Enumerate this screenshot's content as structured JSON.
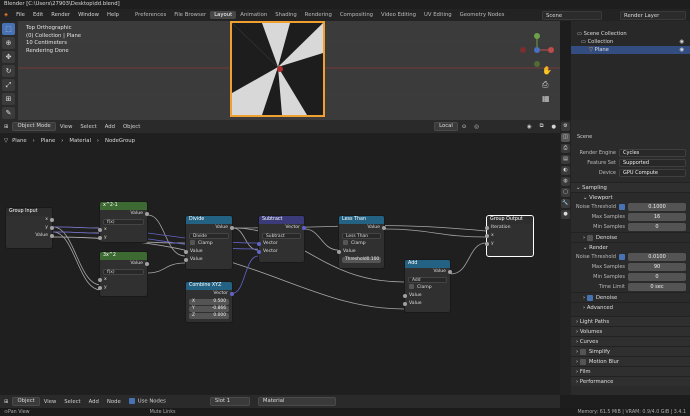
{
  "window": {
    "title": "Blender [C:\\Users\\27903\\Desktop\\dd.blend]"
  },
  "menu": [
    "File",
    "Edit",
    "Render",
    "Window",
    "Help"
  ],
  "workspaces": [
    {
      "label": "Preferences",
      "active": false
    },
    {
      "label": "File Browser",
      "active": false
    },
    {
      "label": "Layout",
      "active": true
    },
    {
      "label": "Animation",
      "active": false
    },
    {
      "label": "Shading",
      "active": false
    },
    {
      "label": "Rendering",
      "active": false
    },
    {
      "label": "Compositing",
      "active": false
    },
    {
      "label": "Video Editing",
      "active": false
    },
    {
      "label": "UV Editing",
      "active": false
    },
    {
      "label": "Geometry Nodes",
      "active": false
    }
  ],
  "scene": {
    "label": "Scene",
    "layer": "Render Layer"
  },
  "viewport": {
    "info": [
      "Top Orthographic",
      "(0) Collection | Plane",
      "10 Centimeters",
      "Rendering Done"
    ],
    "mode": "Object Mode",
    "menu": [
      "View",
      "Select",
      "Add",
      "Object"
    ],
    "pivot": "Local"
  },
  "outliner": {
    "scene_collection": "Scene Collection",
    "collection": "Collection",
    "plane": "Plane"
  },
  "node_editor": {
    "breadcrumb": [
      "Plane",
      "Plane",
      "Material",
      "NodeGroup"
    ],
    "header": {
      "object": "Object",
      "menu": [
        "View",
        "Select",
        "Add",
        "Node"
      ],
      "use_nodes": "Use Nodes",
      "slot": "Slot 1",
      "material": "Material"
    },
    "nodes": {
      "group_input": {
        "title": "Group Input",
        "sockets": [
          "x",
          "y",
          "Value"
        ]
      },
      "sq1": {
        "title": "x^2-1",
        "out": "Value",
        "field": "f(x)",
        "ins": [
          "x",
          "y"
        ]
      },
      "sq2": {
        "title": "3x^2",
        "out": "Value",
        "field": "f(x)",
        "ins": [
          "x",
          "y"
        ]
      },
      "divide": {
        "title": "Divide",
        "out": "Value",
        "op": "Divide",
        "clamp": "Clamp",
        "ins": [
          "Value",
          "Value"
        ]
      },
      "subtract": {
        "title": "Subtract",
        "out": "Vector",
        "op": "Subtract",
        "ins": [
          "Vector",
          "Vector"
        ]
      },
      "less_than": {
        "title": "Less Than",
        "out": "Value",
        "op": "Less Than",
        "clamp": "Clamp",
        "in": "Value",
        "threshold_label": "Threshold",
        "threshold": "0.100"
      },
      "combine": {
        "title": "Combine XYZ",
        "out": "Vector",
        "x_label": "X",
        "x": "0.500",
        "y_label": "Y",
        "y": "-0.866",
        "z_label": "Z",
        "z": "0.000"
      },
      "add": {
        "title": "Add",
        "out": "Value",
        "op": "Add",
        "clamp": "Clamp",
        "ins": [
          "Value",
          "Value"
        ]
      },
      "group_output": {
        "title": "Group Output",
        "sockets": [
          "Iteration",
          "x",
          "y"
        ]
      }
    }
  },
  "properties": {
    "scene": "Scene",
    "render_engine_label": "Render Engine",
    "render_engine": "Cycles",
    "feature_set_label": "Feature Set",
    "feature_set": "Supported",
    "device_label": "Device",
    "device": "GPU Compute",
    "sampling": "Sampling",
    "viewport": "Viewport",
    "noise_threshold_label": "Noise Threshold",
    "vp_noise_threshold": "0.1000",
    "max_samples_label": "Max Samples",
    "vp_max_samples": "16",
    "min_samples_label": "Min Samples",
    "vp_min_samples": "0",
    "denoise": "Denoise",
    "render": "Render",
    "r_noise_threshold": "0.0100",
    "r_max_samples": "90",
    "r_min_samples": "0",
    "time_limit_label": "Time Limit",
    "time_limit": "0 sec",
    "advanced": "Advanced",
    "sections": [
      "Light Paths",
      "Volumes",
      "Curves",
      "Simplify",
      "Motion Blur",
      "Film",
      "Performance"
    ]
  },
  "status": {
    "left": "Pan View",
    "mid": "Mute Links",
    "right": "Memory: 61.5 MiB | VRAM: 0.9/4.0 GiB | 3.4.1"
  }
}
